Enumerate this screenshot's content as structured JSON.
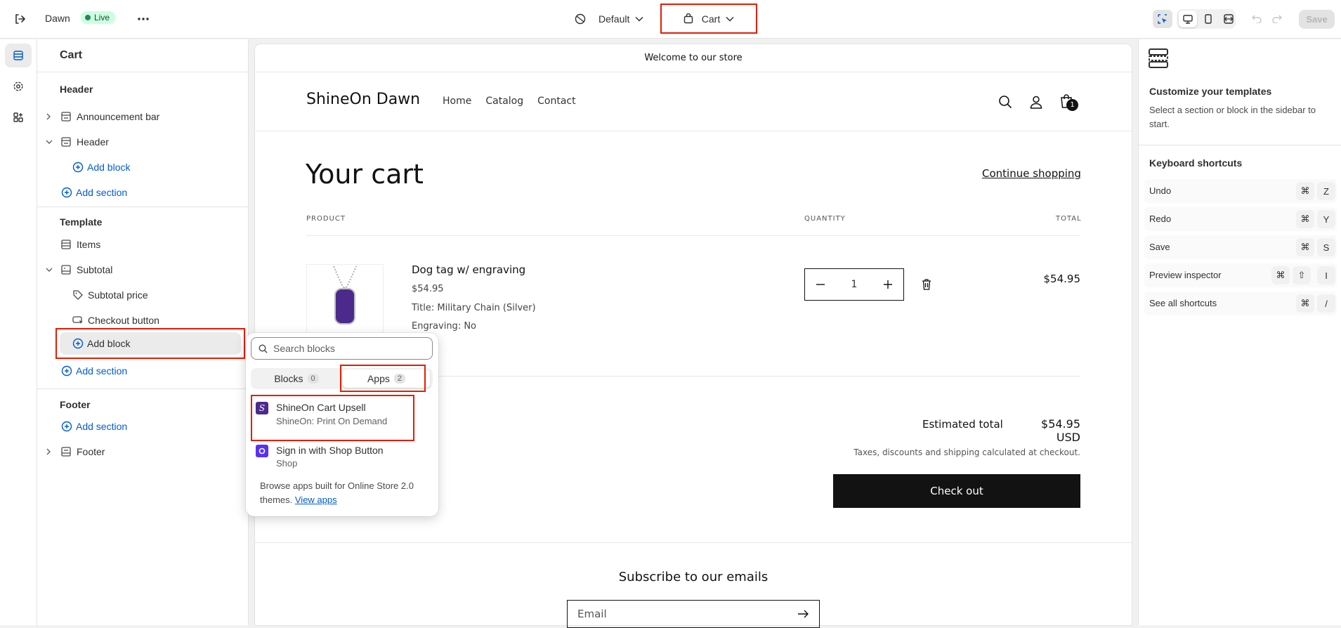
{
  "topbar": {
    "store_name": "Dawn",
    "live_label": "Live",
    "theme_label": "Default",
    "page_label": "Cart",
    "save_label": "Save"
  },
  "sidebar": {
    "title": "Cart",
    "header_group": "Header",
    "announcement_bar": "Announcement bar",
    "header_section": "Header",
    "add_block": "Add block",
    "add_section": "Add section",
    "template_group": "Template",
    "items": "Items",
    "subtotal": "Subtotal",
    "subtotal_price": "Subtotal price",
    "checkout_button": "Checkout button",
    "footer_group": "Footer",
    "footer_section": "Footer"
  },
  "popover": {
    "search_placeholder": "Search blocks",
    "tab_blocks": "Blocks",
    "tab_blocks_count": "0",
    "tab_apps": "Apps",
    "tab_apps_count": "2",
    "apps": [
      {
        "name": "ShineOn Cart Upsell",
        "vendor": "ShineOn: Print On Demand"
      },
      {
        "name": "Sign in with Shop Button",
        "vendor": "Shop"
      }
    ],
    "browse_text": "Browse apps built for Online Store 2.0 themes.",
    "view_apps": "View apps"
  },
  "preview": {
    "announcement": "Welcome to our store",
    "logo": "ShineOn Dawn",
    "nav": [
      "Home",
      "Catalog",
      "Contact"
    ],
    "cart_count": "1",
    "cart_title": "Your cart",
    "continue_shopping": "Continue shopping",
    "col_product": "PRODUCT",
    "col_quantity": "QUANTITY",
    "col_total": "TOTAL",
    "product_name": "Dog tag w/ engraving",
    "product_price": "$54.95",
    "product_option_title": "Title: Military Chain (Silver)",
    "product_option_engraving": "Engraving: No",
    "quantity": "1",
    "line_total": "$54.95",
    "estimated_label": "Estimated total",
    "estimated_value": "$54.95 USD",
    "tax_note": "Taxes, discounts and shipping calculated at checkout.",
    "checkout": "Check out",
    "subscribe_title": "Subscribe to our emails",
    "email_placeholder": "Email"
  },
  "inspector": {
    "title": "Customize your templates",
    "body": "Select a section or block in the sidebar to start.",
    "shortcuts_title": "Keyboard shortcuts",
    "shortcuts": [
      {
        "label": "Undo",
        "keys": [
          "⌘",
          "Z"
        ]
      },
      {
        "label": "Redo",
        "keys": [
          "⌘",
          "Y"
        ]
      },
      {
        "label": "Save",
        "keys": [
          "⌘",
          "S"
        ]
      },
      {
        "label": "Preview inspector",
        "keys": [
          "⌘",
          "⇧",
          "I"
        ]
      },
      {
        "label": "See all shortcuts",
        "keys": [
          "⌘",
          "/"
        ]
      }
    ]
  },
  "colors": {
    "accent": "#005bd3",
    "highlight": "#e51c00",
    "live_bg": "#cdfee1",
    "product": "#4b2a8c"
  }
}
